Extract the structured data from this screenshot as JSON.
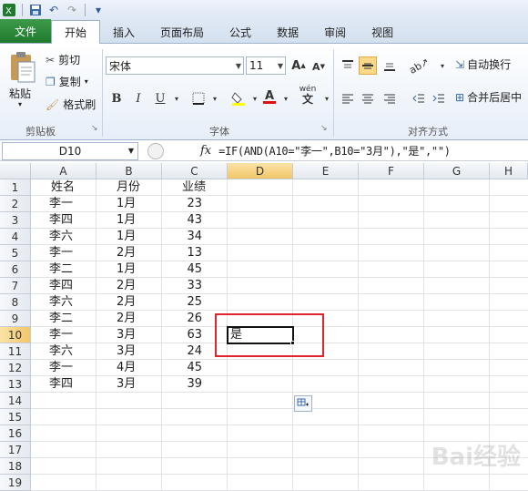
{
  "qat": {
    "undo_label": "↶",
    "redo_label": "↷",
    "customize_label": "▾"
  },
  "tabs": [
    {
      "label": "文件"
    },
    {
      "label": "开始"
    },
    {
      "label": "插入"
    },
    {
      "label": "页面布局"
    },
    {
      "label": "公式"
    },
    {
      "label": "数据"
    },
    {
      "label": "审阅"
    },
    {
      "label": "视图"
    }
  ],
  "clipboard": {
    "paste": "粘贴",
    "cut": "剪切",
    "copy": "复制",
    "format_painter": "格式刷",
    "group": "剪贴板"
  },
  "font": {
    "name": "宋体",
    "size": "11",
    "bold": "B",
    "italic": "I",
    "underline": "U",
    "group": "字体",
    "grow": "A",
    "shrink": "A",
    "wen": "wén"
  },
  "alignment": {
    "wrap": "自动换行",
    "merge": "合并后居中",
    "group": "对齐方式"
  },
  "formula_bar": {
    "name_box": "D10",
    "fx": "fx",
    "formula": "=IF(AND(A10=\"李一\",B10=\"3月\"),\"是\",\"\")"
  },
  "columns": [
    "A",
    "B",
    "C",
    "D",
    "E",
    "F",
    "G",
    "H"
  ],
  "rows": [
    "1",
    "2",
    "3",
    "4",
    "5",
    "6",
    "7",
    "8",
    "9",
    "10",
    "11",
    "12",
    "13",
    "14",
    "15",
    "16",
    "17",
    "18",
    "19"
  ],
  "table": {
    "header": [
      "姓名",
      "月份",
      "业绩"
    ],
    "data": [
      [
        "李一",
        "1月",
        "23"
      ],
      [
        "李四",
        "1月",
        "43"
      ],
      [
        "李六",
        "1月",
        "34"
      ],
      [
        "李一",
        "2月",
        "13"
      ],
      [
        "李二",
        "1月",
        "45"
      ],
      [
        "李四",
        "2月",
        "33"
      ],
      [
        "李六",
        "2月",
        "25"
      ],
      [
        "李二",
        "2月",
        "26"
      ],
      [
        "李一",
        "3月",
        "63"
      ],
      [
        "李六",
        "3月",
        "24"
      ],
      [
        "李一",
        "4月",
        "45"
      ],
      [
        "李四",
        "3月",
        "39"
      ]
    ]
  },
  "d10_value": "是",
  "watermark": "Bai经验",
  "colors": {
    "accent": "#1f7a2e",
    "highlight": "#e0262a"
  }
}
